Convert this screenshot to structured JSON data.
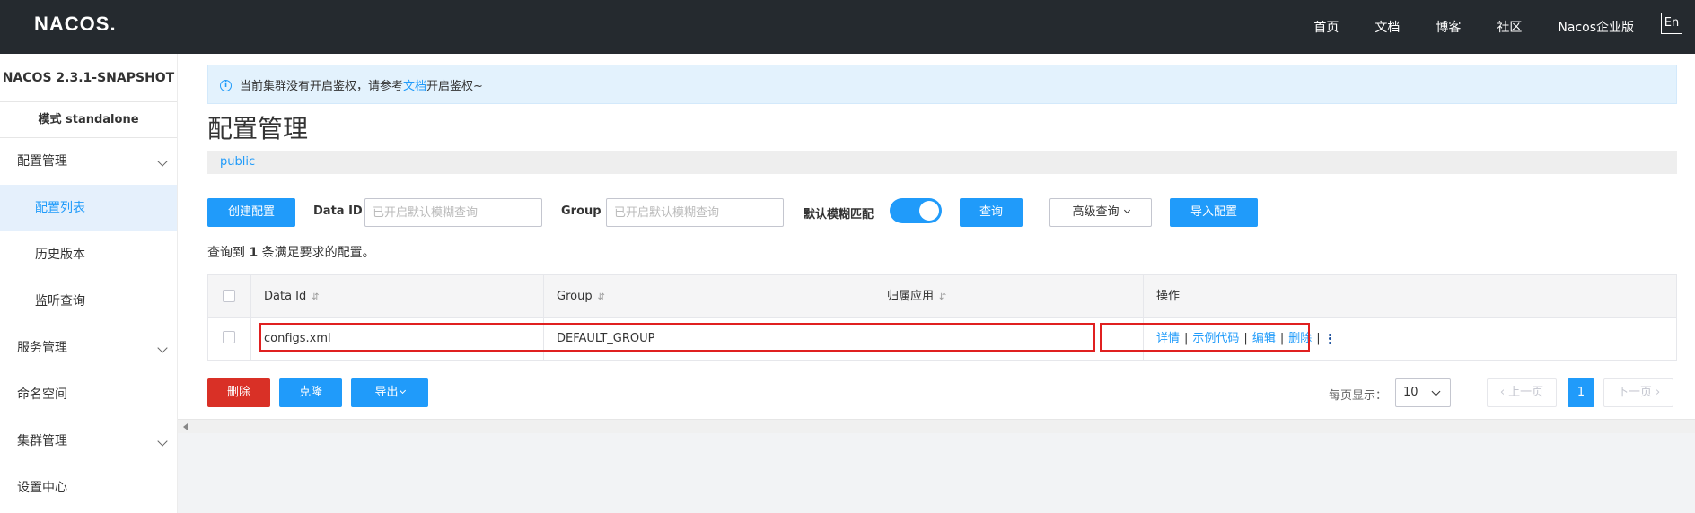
{
  "header": {
    "logo": "NACOS.",
    "nav": [
      "首页",
      "文档",
      "博客",
      "社区",
      "Nacos企业版"
    ],
    "lang": "En"
  },
  "sidebar": {
    "version": "NACOS 2.3.1-SNAPSHOT",
    "mode": "模式 standalone",
    "items": [
      {
        "label": "配置管理"
      },
      {
        "label": "配置列表"
      },
      {
        "label": "历史版本"
      },
      {
        "label": "监听查询"
      },
      {
        "label": "服务管理"
      },
      {
        "label": "命名空间"
      },
      {
        "label": "集群管理"
      },
      {
        "label": "设置中心"
      }
    ]
  },
  "notice": {
    "text_before": "当前集群没有开启鉴权，请参考",
    "link": "文档",
    "text_after": "开启鉴权~"
  },
  "page": {
    "title": "配置管理",
    "namespace": "public"
  },
  "filters": {
    "create_button": "创建配置",
    "data_id_label": "Data ID",
    "data_id_placeholder": "已开启默认模糊查询",
    "group_label": "Group",
    "group_placeholder": "已开启默认模糊查询",
    "fuzzy_label": "默认模糊匹配",
    "fuzzy_on": true,
    "search_button": "查询",
    "advanced_button": "高级查询",
    "import_button": "导入配置"
  },
  "result": {
    "prefix": "查询到",
    "count": "1",
    "suffix": "条满足要求的配置。"
  },
  "table": {
    "headers": [
      "Data Id",
      "Group",
      "归属应用",
      "操作"
    ],
    "rows": [
      {
        "data_id": "configs.xml",
        "group": "DEFAULT_GROUP",
        "app": ""
      }
    ],
    "ops": [
      "详情",
      "示例代码",
      "编辑",
      "删除"
    ]
  },
  "bottom_actions": {
    "delete": "删除",
    "clone": "克隆",
    "export": "导出"
  },
  "pagination": {
    "page_size_label": "每页显示：",
    "page_size": "10",
    "prev": "上一页",
    "current": "1",
    "next": "下一页"
  },
  "colors": {
    "primary": "#209bfa",
    "danger": "#d93026",
    "topbar": "#252a2f",
    "highlight": "#e02020"
  }
}
